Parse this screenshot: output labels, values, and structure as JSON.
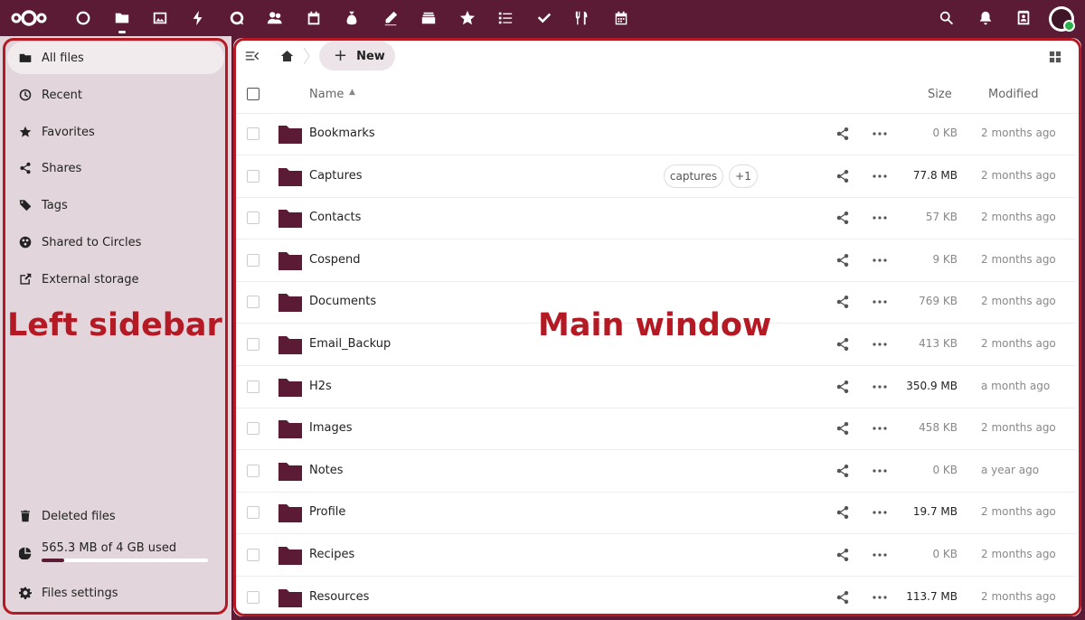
{
  "colors": {
    "brand": "#5b1b34",
    "highlight": "#b51a24",
    "status_online": "#2db24a"
  },
  "topbar": {
    "apps": [
      "dashboard-icon",
      "files-icon",
      "photos-icon",
      "activity-icon",
      "talk-icon",
      "contacts-icon",
      "calendar-icon",
      "cospend-icon",
      "notes-icon",
      "deck-icon",
      "bookmarks-icon",
      "tasks-list-icon",
      "tasks-check-icon",
      "cookbook-icon",
      "calendar-alt-icon"
    ],
    "right": [
      "search-icon",
      "notifications-icon",
      "contacts-menu-icon",
      "user-avatar"
    ]
  },
  "sidebar": {
    "items": [
      {
        "label": "All files",
        "icon": "folder-icon"
      },
      {
        "label": "Recent",
        "icon": "clock-icon"
      },
      {
        "label": "Favorites",
        "icon": "star-icon"
      },
      {
        "label": "Shares",
        "icon": "share-icon"
      },
      {
        "label": "Tags",
        "icon": "tag-icon"
      },
      {
        "label": "Shared to Circles",
        "icon": "circles-icon"
      },
      {
        "label": "External storage",
        "icon": "external-link-icon"
      }
    ],
    "deleted": "Deleted files",
    "quota": {
      "text": "565.3 MB of 4 GB used",
      "fraction": 0.138
    },
    "settings": "Files settings",
    "annotation": "Left sidebar"
  },
  "main": {
    "annotation": "Main window",
    "new_label": "New",
    "columns": {
      "name": "Name",
      "size": "Size",
      "modified": "Modified"
    },
    "files": [
      {
        "name": "Bookmarks",
        "size": "0 KB",
        "modified": "2 months ago"
      },
      {
        "name": "Captures",
        "size": "77.8 MB",
        "modified": "2 months ago",
        "tags": [
          "captures",
          "+1"
        ]
      },
      {
        "name": "Contacts",
        "size": "57 KB",
        "modified": "2 months ago"
      },
      {
        "name": "Cospend",
        "size": "9 KB",
        "modified": "2 months ago"
      },
      {
        "name": "Documents",
        "size": "769 KB",
        "modified": "2 months ago"
      },
      {
        "name": "Email_Backup",
        "size": "413 KB",
        "modified": "2 months ago"
      },
      {
        "name": "H2s",
        "size": "350.9 MB",
        "modified": "a month ago"
      },
      {
        "name": "Images",
        "size": "458 KB",
        "modified": "2 months ago"
      },
      {
        "name": "Notes",
        "size": "0 KB",
        "modified": "a year ago"
      },
      {
        "name": "Profile",
        "size": "19.7 MB",
        "modified": "2 months ago"
      },
      {
        "name": "Recipes",
        "size": "0 KB",
        "modified": "2 months ago"
      },
      {
        "name": "Resources",
        "size": "113.7 MB",
        "modified": "2 months ago"
      }
    ]
  }
}
